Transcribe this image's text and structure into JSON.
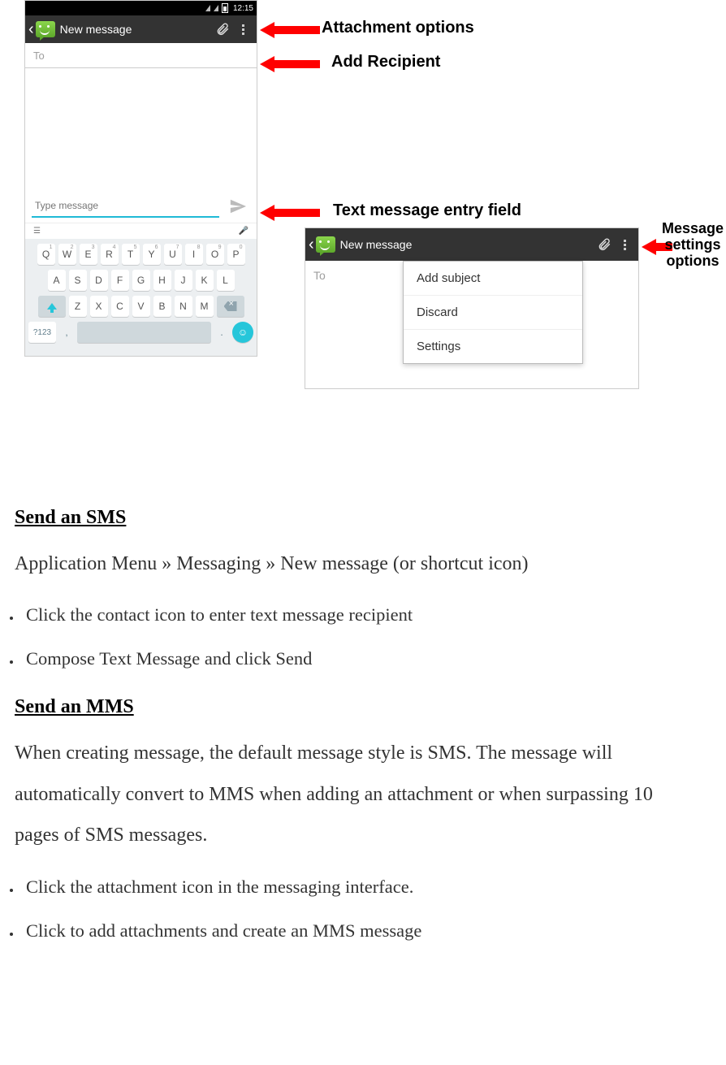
{
  "statusbar": {
    "time": "12:15"
  },
  "titlebar": {
    "title": "New message"
  },
  "to": {
    "label": "To"
  },
  "compose": {
    "placeholder": "Type message"
  },
  "keyboard": {
    "row1": [
      {
        "k": "Q",
        "n": "1"
      },
      {
        "k": "W",
        "n": "2"
      },
      {
        "k": "E",
        "n": "3"
      },
      {
        "k": "R",
        "n": "4"
      },
      {
        "k": "T",
        "n": "5"
      },
      {
        "k": "Y",
        "n": "6"
      },
      {
        "k": "U",
        "n": "7"
      },
      {
        "k": "I",
        "n": "8"
      },
      {
        "k": "O",
        "n": "9"
      },
      {
        "k": "P",
        "n": "0"
      }
    ],
    "row2": [
      "A",
      "S",
      "D",
      "F",
      "G",
      "H",
      "J",
      "K",
      "L"
    ],
    "row3": [
      "Z",
      "X",
      "C",
      "V",
      "B",
      "N",
      "M"
    ],
    "sym": "?123",
    "comma": ",",
    "period": "."
  },
  "popup": {
    "items": [
      "Add subject",
      "Discard",
      "Settings"
    ]
  },
  "annotations": {
    "attachment": "Attachment options",
    "recipient": "Add Recipient",
    "entry": "Text message entry field",
    "settings": "Message settings options"
  },
  "doc": {
    "h_sms": "Send an SMS",
    "p_sms": "Application Menu » Messaging » New message (or shortcut icon)",
    "li_sms_1": "Click the contact icon to enter text message recipient",
    "li_sms_2": "Compose Text Message and click Send",
    "h_mms": "Send an MMS",
    "p_mms": "When creating message, the default message style is SMS. The message will automatically convert to MMS when adding an attachment or when surpassing 10 pages of SMS messages.",
    "li_mms_1": "Click the attachment icon in the messaging interface.",
    "li_mms_2": "Click to add attachments and create an MMS message"
  }
}
